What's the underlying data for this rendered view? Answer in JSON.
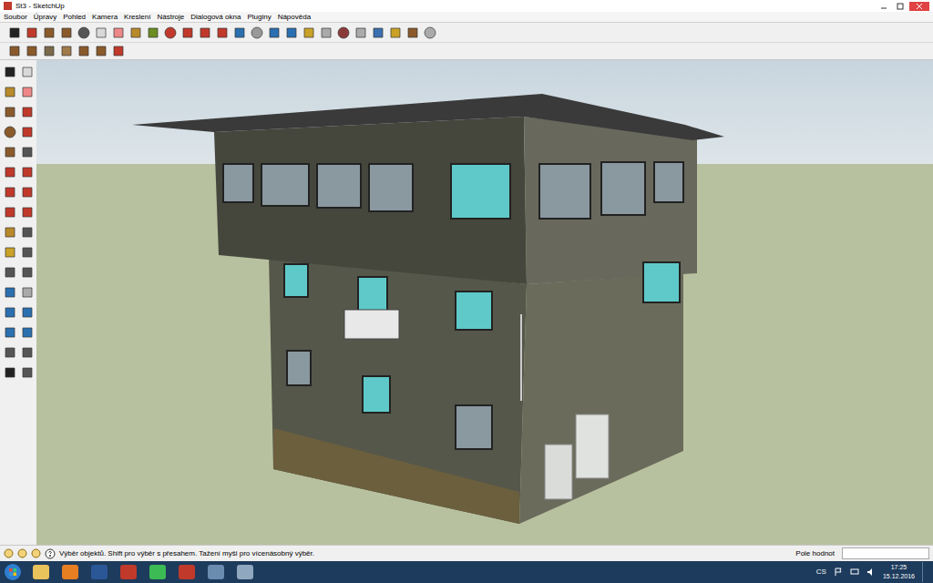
{
  "window": {
    "title": "St3 - SketchUp"
  },
  "menu": [
    "Soubor",
    "Úpravy",
    "Pohled",
    "Kamera",
    "Kreslení",
    "Nástroje",
    "Dialogová okna",
    "Pluginy",
    "Nápověda"
  ],
  "status_bar": {
    "hint": "Výběr objektů. Shift pro výběr s přesahem. Tažení myši pro vícenásobný výběr.",
    "value_label": "Pole hodnot"
  },
  "taskbar": {
    "language": "CS",
    "time": "17:25",
    "date": "15.12.2016"
  }
}
